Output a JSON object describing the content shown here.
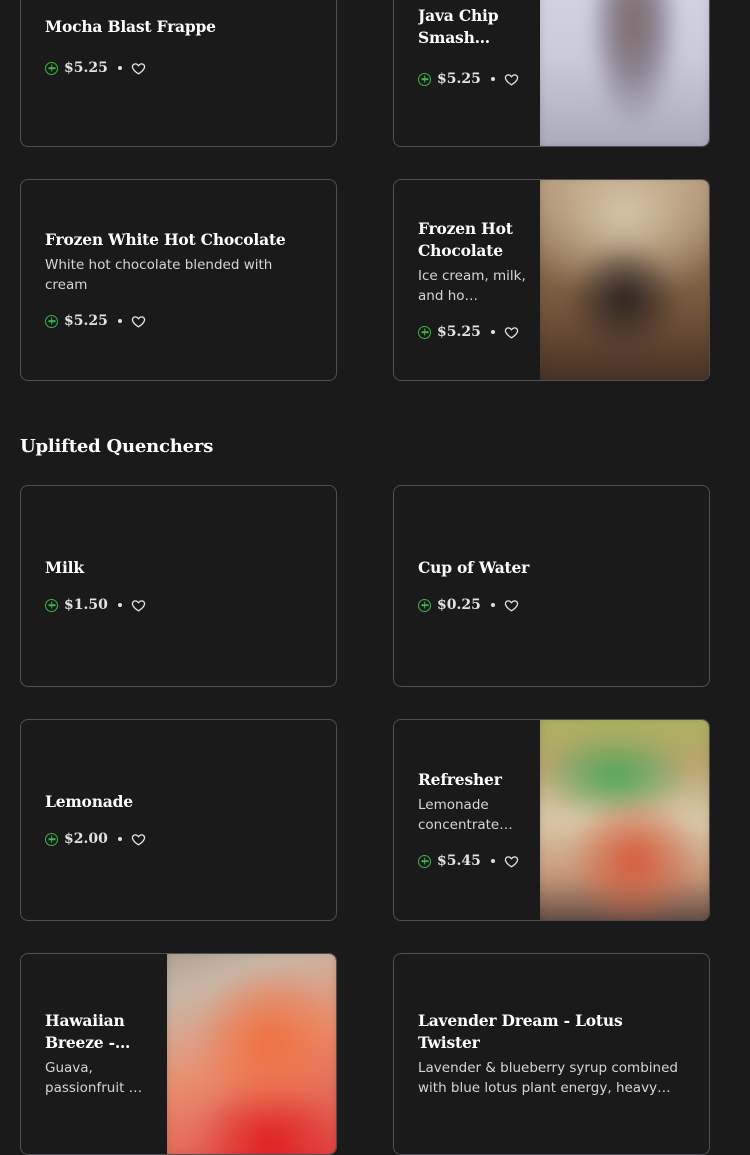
{
  "items": {
    "mocha": {
      "name": "Mocha Blast Frappe",
      "price": "$5.25"
    },
    "javachip": {
      "name": "Java Chip Smash…",
      "price": "$5.25"
    },
    "frozenwhite": {
      "name": "Frozen White Hot Chocolate",
      "desc": "White hot chocolate blended with cream",
      "price": "$5.25"
    },
    "frozenhot": {
      "name": "Frozen Hot Chocolate",
      "desc": "Ice cream, milk, and ho…",
      "price": "$5.25"
    },
    "milk": {
      "name": "Milk",
      "price": "$1.50"
    },
    "water": {
      "name": "Cup of Water",
      "price": "$0.25"
    },
    "lemonade": {
      "name": "Lemonade",
      "price": "$2.00"
    },
    "refresher": {
      "name": "Refresher",
      "desc": "Lemonade concentrate…",
      "price": "$5.45"
    },
    "hawaiian": {
      "name": "Hawaiian Breeze -…",
      "desc": "Guava, passionfruit …"
    },
    "lavender": {
      "name": "Lavender Dream - Lotus Twister",
      "desc": "Lavender & blueberry syrup combined with blue lotus plant energy, heavy crea…"
    }
  },
  "sections": {
    "quenchers_title": "Uplifted Quenchers"
  },
  "icons": {
    "add": "plus-circle-icon",
    "favorite": "heart-icon"
  },
  "colors": {
    "accent": "#3db44a",
    "background": "#1a1a1b",
    "border": "#505052"
  }
}
